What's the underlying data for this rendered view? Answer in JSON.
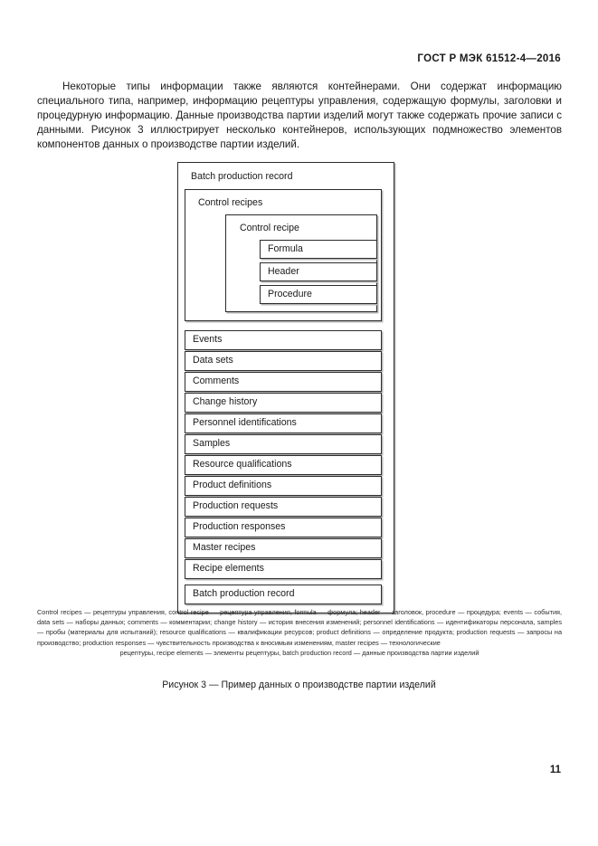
{
  "document": {
    "running_head": "ГОСТ Р МЭК 61512-4—2016",
    "page_number": "11"
  },
  "body": {
    "paragraph": "Некоторые типы информации также являются контейнерами. Они содержат информацию специального типа, например, информацию рецептуры управления, содержащую формулы, заголовки и процедурную информацию. Данные производства партии изделий могут также содержать прочие записи с данными. Рисунок 3 иллюстрирует несколько контейнеров, использующих подмножество элементов компонентов данных о производстве партии изделий."
  },
  "figure": {
    "outer_label": "Batch production record",
    "recipes_label": "Control recipes",
    "recipe_label": "Control recipe",
    "recipe_parts": [
      {
        "label": "Formula"
      },
      {
        "label": "Header"
      },
      {
        "label": "Procedure"
      }
    ],
    "rows": [
      {
        "label": "Events"
      },
      {
        "label": "Data sets"
      },
      {
        "label": "Comments"
      },
      {
        "label": "Change history"
      },
      {
        "label": "Personnel identifications"
      },
      {
        "label": "Samples"
      },
      {
        "label": "Resource qualifications"
      },
      {
        "label": "Product definitions"
      },
      {
        "label": "Production requests"
      },
      {
        "label": "Production responses"
      },
      {
        "label": "Master recipes"
      },
      {
        "label": "Recipe elements"
      },
      {
        "label": "Batch production record"
      }
    ],
    "caption": "Рисунок 3 — Пример данных о производстве партии изделий"
  },
  "glossary": {
    "text": "Control recipes — рецептуры управления, control recipe — рецептура управления, formula — формула; header — заголовок, procedure — процедура; events — события, data sets — наборы данных; comments — комментарии; change history — история внесения изменений; personnel identifications — идентификаторы персонала, samples — пробы (материалы для испытаний); resource qualifications — квалификации ресурсов; product definitions — определение продукта; production requests — запросы на производство; production responses — чувствительность производства к вносимым изменениям, master recipes — технологические",
    "last_line": "рецептуры, recipe elements — элементы рецептуры, batch production record — данные производства партии изделий"
  },
  "colors": {
    "border": "#2b2b2b",
    "shadow": "#b7b7b7",
    "text": "#1a1a1a",
    "page_background": "#ffffff"
  }
}
